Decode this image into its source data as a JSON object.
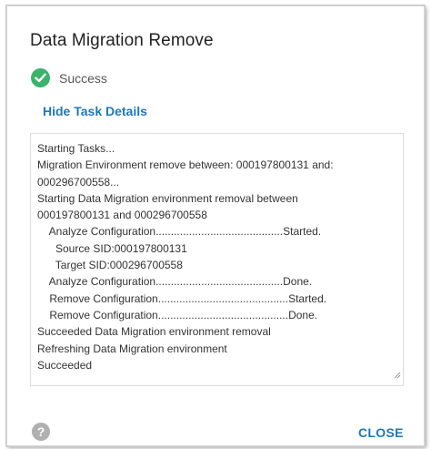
{
  "dialog": {
    "title": "Data Migration Remove",
    "status_text": "Success",
    "toggle_details_label": "Hide Task Details",
    "log_lines": [
      "Starting Tasks...",
      "Migration Environment remove between: 000197800131 and:",
      "000296700558...",
      "Starting Data Migration environment removal between",
      "000197800131 and 000296700558",
      "    Analyze Configuration..........................................Started.",
      "      Source SID:000197800131",
      "      Target SID:000296700558",
      "    Analyze Configuration..........................................Done.",
      "    Remove Configuration...........................................Started.",
      "    Remove Configuration...........................................Done.",
      "Succeeded Data Migration environment removal",
      "Refreshing Data Migration environment",
      "Succeeded"
    ],
    "help_glyph": "?",
    "close_label": "CLOSE"
  },
  "icons": {
    "status": "check-circle-icon",
    "help": "help-icon",
    "resize": "resize-handle-icon"
  },
  "colors": {
    "success": "#3bb36b",
    "link": "#1d78b8",
    "help": "#b0b0b0"
  }
}
